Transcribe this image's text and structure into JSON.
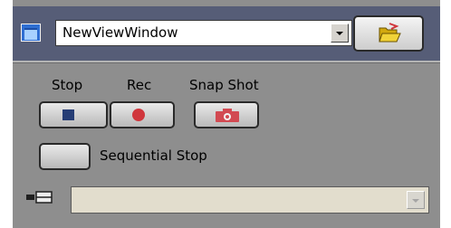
{
  "window_select": {
    "value": "NewViewWindow",
    "icon": "window-icon",
    "arrow_icon": "chevron-down-icon"
  },
  "open_folder": {
    "icon": "open-folder-icon"
  },
  "record_controls": {
    "stop_label": "Stop",
    "rec_label": "Rec",
    "snapshot_label": "Snap Shot",
    "stop_icon": "stop-icon",
    "rec_icon": "record-icon",
    "snapshot_icon": "camera-icon"
  },
  "sequential_stop": {
    "label": "Sequential Stop"
  },
  "secondary_select": {
    "value": "",
    "enabled": false,
    "icon": "device-icon"
  },
  "colors": {
    "header_bg": "#565d77",
    "panel_bg": "#8e8e8e",
    "stop_icon": "#263d75",
    "record_icon": "#d0363c",
    "camera_icon": "#d24a52",
    "folder_icon": "#e6c21c"
  }
}
